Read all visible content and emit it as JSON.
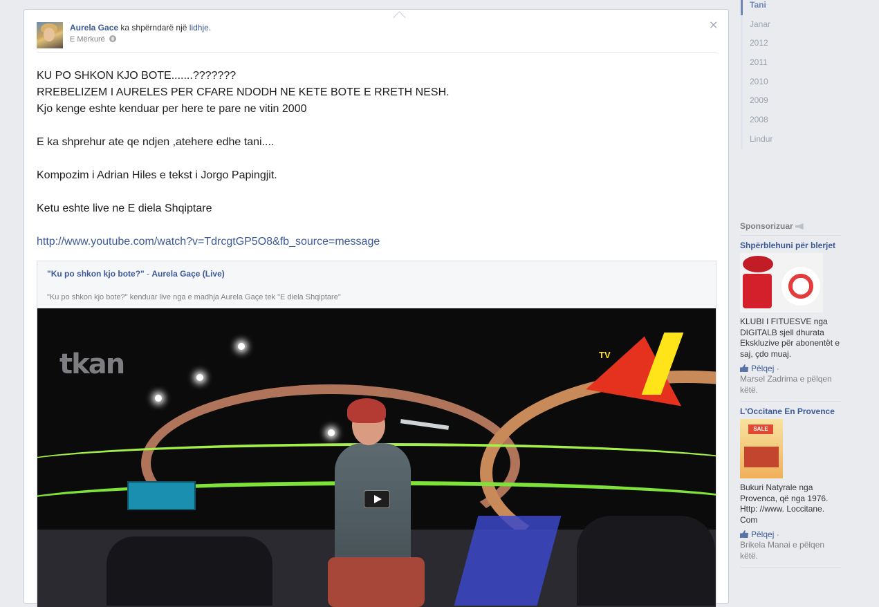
{
  "post": {
    "author": "Aurela Gace",
    "action_text": " ka shpërndarë një ",
    "action_link": "lidhje",
    "action_end": ".",
    "time": "E Mërkurë",
    "close_icon": "×",
    "message_lines": [
      "KU PO SHKON KJO BOTE.......???????",
      "RREBELIZEM I AURELES PER CFARE NDODH NE KETE BOTE E RRETH NESH.",
      "Kjo kenge eshte kenduar per here te pare ne vitin 2000",
      "E ka shprehur ate qe ndjen ,atehere edhe tani....",
      "Kompozim i Adrian Hiles e tekst i Jorgo Papingjit.",
      "Ketu eshte live ne E diela Shqiptare"
    ],
    "url": "http://www.youtube.com/watch?v=TdrcgtGP5O8&fb_source=message",
    "attachment": {
      "title_part1": "\"Ku po shkon kjo bote?\"",
      "title_sep": " - ",
      "title_part2": "Aurela Gaçe (Live)",
      "description": "\"Ku po shkon kjo bote?\" kenduar live nga e madhja Aurela Gaçe tek \"E diela Shqiptare\"",
      "video_logo": "tkan",
      "video_badge": "TV"
    }
  },
  "timeline": [
    "Tani",
    "Janar",
    "2012",
    "2011",
    "2010",
    "2009",
    "2008",
    "Lindur"
  ],
  "sponsored": {
    "heading": "Sponsorizuar",
    "ads": [
      {
        "title": "Shpërblehuni për blerjet",
        "text": "KLUBI I FITUESVE nga DIGITALB sjell dhurata Ekskluzive për abonentët e saj, çdo muaj.",
        "like": "Pëlqej",
        "like_sep": " ·",
        "social": "Marsel Zadrima e pëlqen këtë."
      },
      {
        "title": "L'Occitane En Provence",
        "text": "Bukuri Natyrale nga Provenca, që nga 1976. Http: //www. Loccitane. Com",
        "like": "Pëlqej",
        "like_sep": " ·",
        "social": "Brikela Manai e pëlqen këtë.",
        "img_label": "SALE"
      }
    ]
  },
  "colors": {
    "link": "#3b5998",
    "background": "#e9ebee",
    "timeline_active": "#6d84b4"
  }
}
